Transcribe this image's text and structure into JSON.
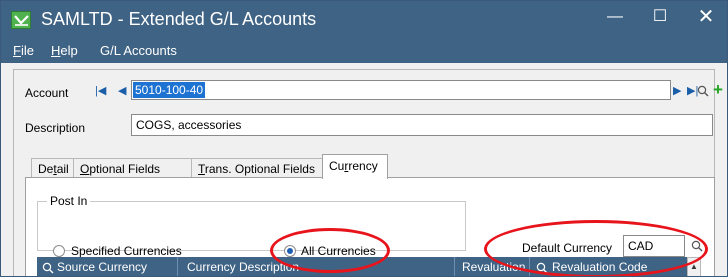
{
  "window": {
    "title": "SAMLTD - Extended G/L Accounts",
    "controls": {
      "minimize": "—",
      "maximize": "☐",
      "close": "✕"
    }
  },
  "menu": {
    "file_prefix": "F",
    "file_rest": "ile",
    "help_prefix": "H",
    "help_rest": "elp",
    "gl_accounts": "G/L Accounts"
  },
  "form": {
    "account_label": "Account",
    "account_value": "5010-100-40",
    "description_label": "Description",
    "description_value": "COGS, accessories"
  },
  "tabs": {
    "detail_a": "De",
    "detail_u": "t",
    "detail_b": "ail",
    "optional_u": "O",
    "optional_b": "ptional Fields",
    "trans_u": "T",
    "trans_b": "rans. Optional Fields",
    "currency_a": "Cu",
    "currency_u": "r",
    "currency_b": "rency",
    "active": "Currency"
  },
  "post_in": {
    "legend": "Post In",
    "options": [
      "Specified Currencies",
      "All Currencies"
    ],
    "selected": "All Currencies"
  },
  "default_currency": {
    "label": "Default Currency",
    "value": "CAD"
  },
  "table": {
    "columns": [
      "Source Currency",
      "Currency Description",
      "Revaluation",
      "Revaluation Code"
    ]
  },
  "colors": {
    "titlebar": "#3f6384",
    "selection": "#1e73d2",
    "highlight_ring": "#e8141b",
    "add": "#23a423"
  }
}
